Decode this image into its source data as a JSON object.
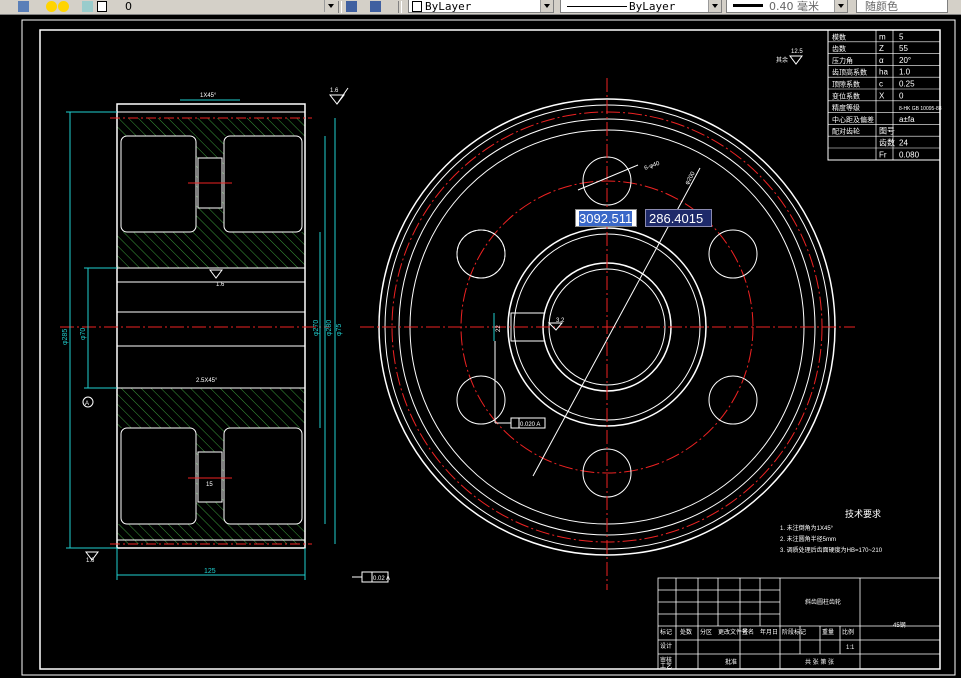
{
  "toolbar": {
    "layer_value": "0",
    "color_value": "ByLayer",
    "linetype_value": "ByLayer",
    "lineweight_value": "0.40 毫米",
    "plotstyle_value": "随颜色"
  },
  "dynamic_input": {
    "length_value": "3092.511",
    "angle_value": "286.4015"
  },
  "param_table": {
    "rows": [
      {
        "name": "模数",
        "sym": "m",
        "val": "5"
      },
      {
        "name": "齿数",
        "sym": "Z",
        "val": "55"
      },
      {
        "name": "压力角",
        "sym": "α",
        "val": "20°"
      },
      {
        "name": "齿顶高系数",
        "sym": "ha",
        "val": "1.0"
      },
      {
        "name": "顶隙系数",
        "sym": "c",
        "val": "0.25"
      },
      {
        "name": "变位系数",
        "sym": "X",
        "val": "0"
      },
      {
        "name": "精度等级",
        "sym": "",
        "val": "8-HK GB 10095-88"
      },
      {
        "name": "中心距及偏差",
        "sym": "",
        "val": "a±fa"
      },
      {
        "name": "配对齿轮",
        "sym": "图号",
        "val": ""
      },
      {
        "name": "",
        "sym": "齿数",
        "val": "24"
      },
      {
        "name": "",
        "sym": "Fr",
        "val": "0.080"
      }
    ]
  },
  "dims": {
    "chamfer_top": "1X45°",
    "chamfer_mid": "2.5X45°",
    "roughness_top": "1.6",
    "roughness_hub": "1.6",
    "roughness_bottom": "1.6",
    "roughness_general": "12.5",
    "roughness_note": "其余",
    "width_bottom": "125",
    "hole_note": "6-φ40",
    "pcd_note": "φ200",
    "key_width": "22",
    "key_rough": "3.2",
    "tol_frame_side": "0.02 A",
    "tol_frame_front": "0.020 A",
    "datum_a": "A",
    "dia_1": "φ285",
    "dia_2": "φ270",
    "dia_3": "φ280",
    "dia_4": "φ70",
    "dia_5": "φ75"
  },
  "tech_req": {
    "title": "技术要求",
    "items": [
      "1.  未注倒角为1X45°",
      "2.  未注圆角半径5mm",
      "3.  调质处理后齿面硬度为HB=170~210"
    ]
  },
  "title_block": {
    "part_name": "斜齿圆柱齿轮",
    "material": "45钢",
    "scale": "1:1",
    "design_label": "设计",
    "check_label": "审核",
    "process_label": "工艺",
    "approve_label": "批准",
    "mark_label": "标记",
    "count_label": "处数",
    "zone_label": "分区",
    "change_label": "更改文件号",
    "sign_label": "签名",
    "date_label": "年月日",
    "stage_label": "阶段标记",
    "weight_label": "重量",
    "scale_label": "比例",
    "sheet_label": "共 张 第 张"
  }
}
